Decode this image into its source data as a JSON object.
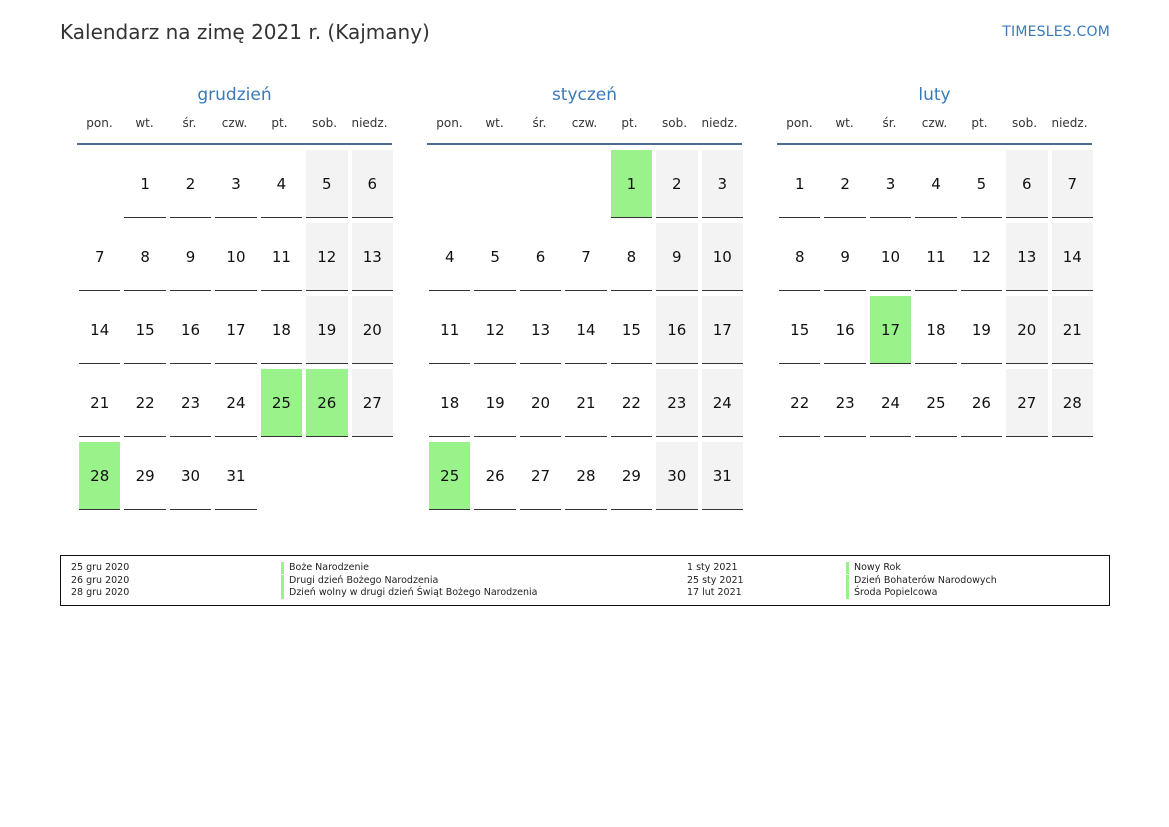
{
  "header": {
    "title": "Kalendarz na zimę 2021 r. (Kajmany)",
    "site": "TIMESLES.COM"
  },
  "colors": {
    "accent": "#3a7ab8",
    "holiday": "#99f28a",
    "weekend": "#f3f3f3",
    "rule": "#4f6a8f"
  },
  "weekdays": [
    "pon.",
    "wt.",
    "śr.",
    "czw.",
    "pt.",
    "sob.",
    "niedz."
  ],
  "months": [
    {
      "name": "grudzień",
      "offset": 1,
      "days": 31,
      "holidays": [
        25,
        26,
        28
      ]
    },
    {
      "name": "styczeń",
      "offset": 4,
      "days": 31,
      "holidays": [
        1,
        25
      ]
    },
    {
      "name": "luty",
      "offset": 0,
      "days": 28,
      "holidays": [
        17
      ]
    }
  ],
  "legend": [
    {
      "date": "25 gru 2020",
      "name": "Boże Narodzenie"
    },
    {
      "date": "26 gru 2020",
      "name": "Drugi dzień Bożego Narodzenia"
    },
    {
      "date": "28 gru 2020",
      "name": "Dzień wolny w drugi dzień Świąt Bożego Narodzenia"
    },
    {
      "date": "1 sty 2021",
      "name": "Nowy Rok"
    },
    {
      "date": "25 sty 2021",
      "name": "Dzień Bohaterów Narodowych"
    },
    {
      "date": "17 lut 2021",
      "name": "Środa Popielcowa"
    }
  ]
}
